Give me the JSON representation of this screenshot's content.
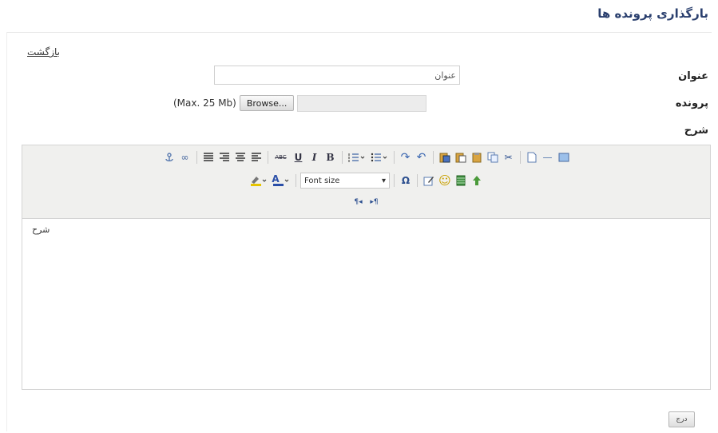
{
  "page": {
    "title": "بارگذاری پرونده ها",
    "back_link": "بازگشت"
  },
  "form": {
    "title_label": "عنوان",
    "title_value": "عنوان",
    "file_label": "پرونده",
    "max_size": "(Max. 25 Mb)",
    "browse_label": "Browse...",
    "description_label": "شرح",
    "submit_label": "درج"
  },
  "editor": {
    "font_size_placeholder": "Font size",
    "content": "شرح",
    "toolbar_row1": [
      "anchor-icon",
      "link-icon",
      "align-justify-icon",
      "align-right-icon",
      "align-center-icon",
      "align-left-icon",
      "strikethrough-icon",
      "underline-icon",
      "italic-icon",
      "bold-icon",
      "ordered-list-icon",
      "unordered-list-icon",
      "redo-icon",
      "undo-icon",
      "paste-word-icon",
      "paste-text-icon",
      "paste-icon",
      "copy-icon",
      "cut-icon",
      "new-document-icon",
      "horizontal-rule-icon",
      "image-icon"
    ],
    "toolbar_row2": [
      "highlight-color-icon",
      "font-color-icon",
      "font-size-select",
      "special-char-icon",
      "edit-icon",
      "emoticon-icon",
      "media-icon",
      "image-insert-icon"
    ],
    "toolbar_row3": [
      "rtl-icon",
      "ltr-icon"
    ]
  },
  "glyphs": {
    "bold": "B",
    "italic": "I",
    "underline": "U",
    "strike": "ABC",
    "font_color": "A",
    "omega": "Ω",
    "smile": "☺",
    "undo": "↶",
    "redo": "↷",
    "cut": "✂",
    "link": "∞",
    "rule": "—",
    "rtl": "¶◂",
    "ltr": "▸¶",
    "dropdown": "▾"
  }
}
